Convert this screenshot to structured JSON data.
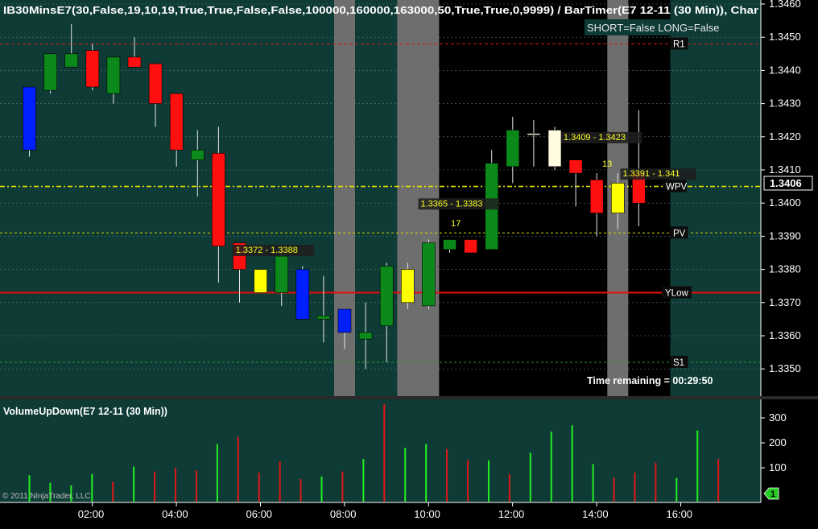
{
  "app": {
    "copyright": "© 2011 NinjaTrader, LLC",
    "panel_index": "1"
  },
  "main_panel": {
    "header": "IB30MinsE7(30,False,19,10,19,True,True,False,False,100000,160000,163000,50,True,True,0,9999)  /  BarTimer(E7  12-11  (30 Min)),  Char",
    "signal_box": "SHORT=False LONG=False",
    "time_remaining": "Time remaining = 00:29:50",
    "current_price": "1.3406"
  },
  "volume_panel": {
    "title": "VolumeUpDown(E7 12-11 (30 Min))"
  },
  "colors": {
    "panel_bg": "#0e3b36",
    "session_bg": "#000000",
    "gray_band": "#6e6e6e",
    "up": "#0b8a1b",
    "down": "#ff1010",
    "ib_up": "#ffff00",
    "ib_down": "#0020ff",
    "cream": "#fffbe0",
    "volume_up": "#22ee22",
    "volume_down": "#dd1818"
  },
  "chart_data": {
    "type": "candlestick",
    "price_axis": {
      "range": [
        1.3342,
        1.346
      ],
      "ticks": [
        "1.3460",
        "1.3450",
        "1.3440",
        "1.3430",
        "1.3420",
        "1.3410",
        "1.3400",
        "1.3390",
        "1.3380",
        "1.3370",
        "1.3360",
        "1.3350"
      ]
    },
    "time_axis": {
      "labels": [
        "02:00",
        "04:00",
        "06:00",
        "08:00",
        "10:00",
        "12:00",
        "14:00",
        "16:00"
      ],
      "label_bar_index": [
        2,
        6,
        10,
        14,
        18,
        22,
        26,
        30
      ]
    },
    "volume_axis": {
      "range": [
        0,
        360
      ],
      "ticks": [
        100,
        200,
        300
      ]
    },
    "session_shading": {
      "gray_bands_bar_index": [
        15,
        18.5,
        28
      ],
      "black_session_bar_range": [
        19,
        30.5
      ]
    },
    "levels": [
      {
        "label": "R1",
        "price": 1.3448,
        "style": "dashed-red"
      },
      {
        "label": "WPV",
        "price": 1.3405,
        "style": "dash-dot-yellow"
      },
      {
        "label": "PV",
        "price": 1.3391,
        "style": "dashed-yellow"
      },
      {
        "label": "YLow",
        "price": 1.3373,
        "style": "solid-red"
      },
      {
        "label": "S1",
        "price": 1.3352,
        "style": "dashed-green"
      }
    ],
    "range_labels": [
      {
        "text": "1.3372 - 1.3388",
        "bar": 11.6,
        "price": 1.3385
      },
      {
        "text": "1.3365 - 1.3383",
        "bar": 20.4,
        "price": 1.3399
      },
      {
        "text": "17",
        "bar": 20.3,
        "price": 1.3393
      },
      {
        "text": "1.3409 - 1.3423",
        "bar": 27.2,
        "price": 1.3419
      },
      {
        "text": "13",
        "bar": 27.5,
        "price": 1.3411
      },
      {
        "text": "1.3391 - 1.341",
        "bar": 29.9,
        "price": 1.3408
      }
    ],
    "bars": [
      {
        "o": 1.3416,
        "h": 1.3414,
        "l": 1.3414,
        "c": 1.3435,
        "color": "ib_down"
      },
      {
        "o": 1.3434,
        "h": 1.3445,
        "l": 1.3433,
        "c": 1.3445,
        "color": "up"
      },
      {
        "o": 1.3441,
        "h": 1.3454,
        "l": 1.3441,
        "c": 1.3445,
        "color": "up"
      },
      {
        "o": 1.3446,
        "h": 1.3448,
        "l": 1.3434,
        "c": 1.3435,
        "color": "down"
      },
      {
        "o": 1.3433,
        "h": 1.3444,
        "l": 1.343,
        "c": 1.3444,
        "color": "up"
      },
      {
        "o": 1.3444,
        "h": 1.345,
        "l": 1.3441,
        "c": 1.3441,
        "color": "down"
      },
      {
        "o": 1.3442,
        "h": 1.3442,
        "l": 1.3423,
        "c": 1.343,
        "color": "down"
      },
      {
        "o": 1.3433,
        "h": 1.3433,
        "l": 1.3411,
        "c": 1.3416,
        "color": "down"
      },
      {
        "o": 1.3416,
        "h": 1.3422,
        "l": 1.3402,
        "c": 1.3413,
        "color": "up"
      },
      {
        "o": 1.3415,
        "h": 1.3423,
        "l": 1.3376,
        "c": 1.3387,
        "color": "down"
      },
      {
        "o": 1.3388,
        "h": 1.3387,
        "l": 1.337,
        "c": 1.338,
        "color": "down"
      },
      {
        "o": 1.3373,
        "h": 1.3373,
        "l": 1.3373,
        "c": 1.338,
        "color": "ib_up"
      },
      {
        "o": 1.3373,
        "h": 1.3387,
        "l": 1.3369,
        "c": 1.3384,
        "color": "up"
      },
      {
        "o": 1.338,
        "h": 1.3381,
        "l": 1.3365,
        "c": 1.3365,
        "color": "ib_down"
      },
      {
        "o": 1.3366,
        "h": 1.3378,
        "l": 1.3358,
        "c": 1.3365,
        "color": "up"
      },
      {
        "o": 1.3368,
        "h": 1.3362,
        "l": 1.3356,
        "c": 1.3361,
        "color": "ib_down"
      },
      {
        "o": 1.3361,
        "h": 1.337,
        "l": 1.335,
        "c": 1.3359,
        "color": "up"
      },
      {
        "o": 1.3363,
        "h": 1.3382,
        "l": 1.3352,
        "c": 1.3381,
        "color": "up"
      },
      {
        "o": 1.338,
        "h": 1.3382,
        "l": 1.3368,
        "c": 1.337,
        "color": "ib_up"
      },
      {
        "o": 1.3369,
        "h": 1.3389,
        "l": 1.3368,
        "c": 1.3388,
        "color": "up"
      },
      {
        "o": 1.3386,
        "h": 1.3389,
        "l": 1.3385,
        "c": 1.3389,
        "color": "up"
      },
      {
        "o": 1.3389,
        "h": 1.3389,
        "l": 1.3385,
        "c": 1.3385,
        "color": "down"
      },
      {
        "o": 1.3386,
        "h": 1.3416,
        "l": 1.3386,
        "c": 1.3412,
        "color": "up"
      },
      {
        "o": 1.3411,
        "h": 1.3426,
        "l": 1.3406,
        "c": 1.3422,
        "color": "up"
      },
      {
        "o": 1.3421,
        "h": 1.3425,
        "l": 1.3411,
        "c": 1.3421,
        "color": "cream"
      },
      {
        "o": 1.3422,
        "h": 1.3423,
        "l": 1.341,
        "c": 1.3411,
        "color": "cream"
      },
      {
        "o": 1.3413,
        "h": 1.3413,
        "l": 1.3399,
        "c": 1.3409,
        "color": "down"
      },
      {
        "o": 1.3407,
        "h": 1.3409,
        "l": 1.339,
        "c": 1.3397,
        "color": "down"
      },
      {
        "o": 1.3397,
        "h": 1.3409,
        "l": 1.3392,
        "c": 1.3406,
        "color": "ib_up"
      },
      {
        "o": 1.3409,
        "h": 1.3428,
        "l": 1.3393,
        "c": 1.34,
        "color": "down"
      }
    ],
    "volume": [
      {
        "v": 70,
        "dir": "up"
      },
      {
        "v": 40,
        "dir": "up"
      },
      {
        "v": 30,
        "dir": "up"
      },
      {
        "v": 75,
        "dir": "up"
      },
      {
        "v": 45,
        "dir": "down"
      },
      {
        "v": 105,
        "dir": "up"
      },
      {
        "v": 85,
        "dir": "down"
      },
      {
        "v": 100,
        "dir": "down"
      },
      {
        "v": 90,
        "dir": "down"
      },
      {
        "v": 195,
        "dir": "up"
      },
      {
        "v": 225,
        "dir": "down"
      },
      {
        "v": 80,
        "dir": "down"
      },
      {
        "v": 125,
        "dir": "down"
      },
      {
        "v": 55,
        "dir": "down"
      },
      {
        "v": 65,
        "dir": "up"
      },
      {
        "v": 85,
        "dir": "down"
      },
      {
        "v": 135,
        "dir": "up"
      },
      {
        "v": 355,
        "dir": "down"
      },
      {
        "v": 180,
        "dir": "up"
      },
      {
        "v": 195,
        "dir": "up"
      },
      {
        "v": 175,
        "dir": "down"
      },
      {
        "v": 130,
        "dir": "down"
      },
      {
        "v": 130,
        "dir": "up"
      },
      {
        "v": 75,
        "dir": "down"
      },
      {
        "v": 160,
        "dir": "up"
      },
      {
        "v": 245,
        "dir": "up"
      },
      {
        "v": 270,
        "dir": "up"
      },
      {
        "v": 115,
        "dir": "up"
      },
      {
        "v": 60,
        "dir": "down"
      },
      {
        "v": 80,
        "dir": "down"
      },
      {
        "v": 120,
        "dir": "down"
      },
      {
        "v": 60,
        "dir": "up"
      },
      {
        "v": 250,
        "dir": "up"
      },
      {
        "v": 135,
        "dir": "down"
      }
    ]
  }
}
